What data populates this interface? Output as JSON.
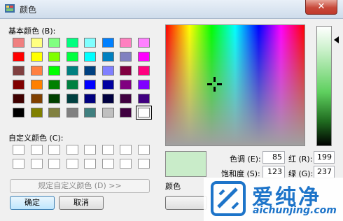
{
  "window": {
    "title": "颜色",
    "close_label": "✕"
  },
  "basic_colors_label": "基本颜色 (B):",
  "basic_colors": [
    [
      "#f08080",
      "#ffff80",
      "#80ff80",
      "#00ff80",
      "#80ffff",
      "#0080ff",
      "#ff80c0",
      "#ff80ff"
    ],
    [
      "#ff0000",
      "#ffff00",
      "#80ff00",
      "#00ff40",
      "#00ffff",
      "#0080c0",
      "#8080c0",
      "#ff00ff"
    ],
    [
      "#804040",
      "#ff8040",
      "#00ff00",
      "#008080",
      "#004080",
      "#8080ff",
      "#800040",
      "#ff0080"
    ],
    [
      "#800000",
      "#ff8000",
      "#008000",
      "#008040",
      "#0000ff",
      "#0000a0",
      "#800080",
      "#8000ff"
    ],
    [
      "#400000",
      "#804000",
      "#004000",
      "#004040",
      "#000080",
      "#000040",
      "#400040",
      "#400080"
    ],
    [
      "#000000",
      "#808000",
      "#808040",
      "#808080",
      "#408080",
      "#c0c0c0",
      "#400040",
      "#ffffff"
    ]
  ],
  "custom_colors_label": "自定义颜色 (C):",
  "buttons": {
    "define_custom": "规定自定义颜色 (D) >>",
    "ok": "确定",
    "cancel": "取消"
  },
  "color_solid_label": "颜色",
  "fields": {
    "hue_label": "色调 (E):",
    "hue": "85",
    "sat_label": "饱和度 (S):",
    "sat": "123",
    "red_label": "红 (R):",
    "red": "199",
    "green_label": "绿 (G):",
    "green": "237"
  },
  "watermark": {
    "brand": "爱纯净",
    "url": "aichunjing.com"
  }
}
